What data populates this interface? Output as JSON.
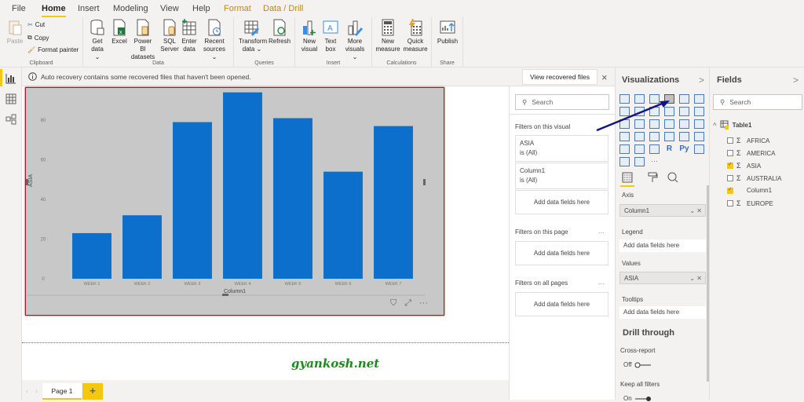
{
  "menu": {
    "tabs": [
      {
        "label": "File"
      },
      {
        "label": "Home"
      },
      {
        "label": "Insert"
      },
      {
        "label": "Modeling"
      },
      {
        "label": "View"
      },
      {
        "label": "Help"
      },
      {
        "label": "Format"
      },
      {
        "label": "Data / Drill"
      }
    ],
    "active": "Home"
  },
  "ribbon": {
    "clipboard": {
      "label": "Clipboard",
      "paste": "Paste",
      "cut": "Cut",
      "copy": "Copy",
      "format_painter": "Format painter"
    },
    "data": {
      "label": "Data",
      "get_data": [
        "Get",
        "data ⌄"
      ],
      "excel": "Excel",
      "pbi_datasets": [
        "Power BI",
        "datasets"
      ],
      "sql": [
        "SQL",
        "Server"
      ],
      "enter_data": [
        "Enter",
        "data"
      ],
      "recent": [
        "Recent",
        "sources ⌄"
      ]
    },
    "queries": {
      "label": "Queries",
      "transform": [
        "Transform",
        "data ⌄"
      ],
      "refresh": "Refresh"
    },
    "insert": {
      "label": "Insert",
      "new_visual": [
        "New",
        "visual"
      ],
      "text_box": [
        "Text",
        "box"
      ],
      "more_visuals": [
        "More",
        "visuals ⌄"
      ]
    },
    "calculations": {
      "label": "Calculations",
      "new_measure": [
        "New",
        "measure"
      ],
      "quick_measure": [
        "Quick",
        "measure"
      ]
    },
    "share": {
      "label": "Share",
      "publish": "Publish"
    }
  },
  "notification": {
    "text": "Auto recovery contains some recovered files that haven't been opened.",
    "button": "View recovered files",
    "close": "×"
  },
  "chart_data": {
    "type": "bar",
    "title": "",
    "categories": [
      "WEEK 1",
      "WEEK 2",
      "WEEK 3",
      "WEEK 4",
      "WEEK 5",
      "WEEK 6",
      "WEEK 7"
    ],
    "values": [
      23,
      32,
      79,
      94,
      81,
      54,
      77
    ],
    "xlabel": "Column1",
    "ylabel": "ASIA",
    "ylim": [
      0,
      95
    ],
    "yticks": [
      0,
      20,
      40,
      60,
      80
    ],
    "grid": false,
    "bar_color": "#0d6fcc",
    "background": "#c8c8c8"
  },
  "visual_header": {
    "filter": "⛉",
    "focus": "⤢",
    "more": "···"
  },
  "watermark": "gyankosh.net",
  "pages": {
    "tabs": [
      "Page 1"
    ],
    "add": "+"
  },
  "filters": {
    "search_placeholder": "Search",
    "on_visual": {
      "title": "Filters on this visual",
      "cards": [
        {
          "field": "ASIA",
          "state": "is (All)"
        },
        {
          "field": "Column1",
          "state": "is (All)"
        }
      ],
      "add": "Add data fields here"
    },
    "on_page": {
      "title": "Filters on this page",
      "more": "...",
      "add": "Add data fields here"
    },
    "on_all": {
      "title": "Filters on all pages",
      "more": "...",
      "add": "Add data fields here"
    }
  },
  "visualizations": {
    "title": "Visualizations",
    "chevron": ">",
    "wells": {
      "axis": {
        "label": "Axis",
        "value": "Column1"
      },
      "legend": {
        "label": "Legend",
        "placeholder": "Add data fields here"
      },
      "values": {
        "label": "Values",
        "value": "ASIA"
      },
      "tooltips": {
        "label": "Tooltips",
        "placeholder": "Add data fields here"
      }
    },
    "drill": {
      "title": "Drill through",
      "cross_report": {
        "label": "Cross-report",
        "state": "Off"
      },
      "keep_filters": {
        "label": "Keep all filters",
        "state": "On"
      }
    }
  },
  "fields": {
    "title": "Fields",
    "chevron": ">",
    "search_placeholder": "Search",
    "table": "Table1",
    "items": [
      {
        "name": "AFRICA",
        "sigma": true,
        "checked": false
      },
      {
        "name": "AMERICA",
        "sigma": true,
        "checked": false
      },
      {
        "name": "ASIA",
        "sigma": true,
        "checked": true
      },
      {
        "name": "AUSTRALIA",
        "sigma": true,
        "checked": false
      },
      {
        "name": "Column1",
        "sigma": false,
        "checked": true
      },
      {
        "name": "EUROPE",
        "sigma": true,
        "checked": false
      }
    ]
  },
  "colors": {
    "accent": "#f2c811",
    "bar": "#0d6fcc",
    "visual_border": "#9b1c24",
    "annotation_arrow": "#141480"
  }
}
